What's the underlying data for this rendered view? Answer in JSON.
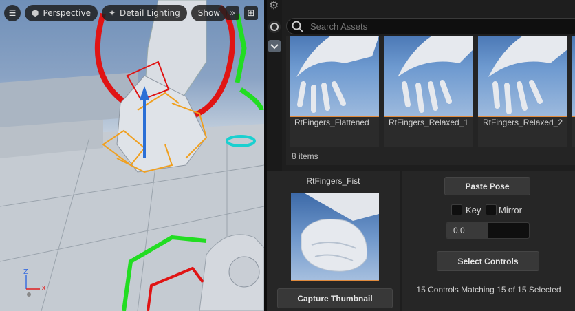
{
  "viewport": {
    "view_mode": "Perspective",
    "lighting_mode": "Detail Lighting",
    "show_label": "Show",
    "axis_labels": {
      "x": "X",
      "z": "Z"
    }
  },
  "asset_browser": {
    "search_placeholder": "Search Assets",
    "assets": [
      {
        "name": "RtFingers_Flattened"
      },
      {
        "name": "RtFingers_Relaxed_1"
      },
      {
        "name": "RtFingers_Relaxed_2"
      }
    ],
    "item_count": "8 items"
  },
  "pose_panel": {
    "selected_pose": "RtFingers_Fist",
    "capture_button": "Capture Thumbnail",
    "paste_button": "Paste Pose",
    "key_label": "Key",
    "mirror_label": "Mirror",
    "blend_value": "0.0",
    "select_button": "Select Controls",
    "matching_text": "15 Controls Matching 15 of 15 Selected"
  },
  "colors": {
    "accent_orange": "#e08a3c",
    "panel_bg": "#262626",
    "thumb_blue": "#6e9ad0"
  }
}
